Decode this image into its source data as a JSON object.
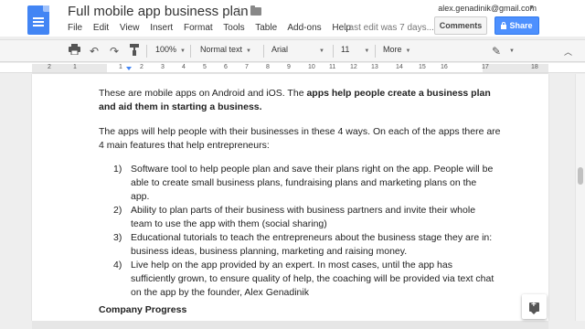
{
  "header": {
    "title": "Full mobile app business plan",
    "menu": [
      "File",
      "Edit",
      "View",
      "Insert",
      "Format",
      "Tools",
      "Table",
      "Add-ons",
      "Help"
    ],
    "last_edit": "Last edit was 7 days...",
    "account": "alex.genadinik@gmail.com",
    "comments_label": "Comments",
    "share_label": "Share"
  },
  "toolbar": {
    "zoom": "100%",
    "style": "Normal text",
    "font": "Arial",
    "size": "11",
    "more": "More"
  },
  "ruler": {
    "numbers": [
      "2",
      "1",
      "1",
      "2",
      "3",
      "4",
      "5",
      "6",
      "7",
      "8",
      "9",
      "10",
      "11",
      "12",
      "13",
      "14",
      "15",
      "16",
      "17",
      "18"
    ]
  },
  "document": {
    "para1_plain": "These are mobile apps on Android and iOS. The ",
    "para1_bold": "apps help people create a business plan and aid them in starting a business.",
    "para2": "The apps will help people with their businesses in these 4 ways. On each of the apps there are 4 main features that help entrepreneurs:",
    "list": [
      {
        "num": "1)",
        "text": "Software tool to help people plan and save their plans right on the app. People will be able to create small business plans, fundraising plans and marketing plans on the app."
      },
      {
        "num": "2)",
        "text": "Ability to plan parts of their business with business partners and invite their whole team to use the app with them (social sharing)"
      },
      {
        "num": "3)",
        "text": "Educational tutorials to teach the entrepreneurs about the business stage they are in: business ideas, business planning, marketing and raising money."
      },
      {
        "num": "4)",
        "text": "Live help on the app provided by an expert. In most cases, until the app has sufficiently grown, to ensure quality of help, the coaching will be provided via text chat on the app by the founder, Alex Genadinik"
      }
    ],
    "heading": "Company Progress"
  },
  "icons": {
    "star": "star-icon",
    "folder": "folder-icon",
    "print": "print-icon",
    "undo": "undo-icon",
    "redo": "redo-icon",
    "paint_format": "paint-format-icon",
    "pen": "pen-icon",
    "explore": "explore-icon"
  },
  "colors": {
    "accent": "#4285f4",
    "share": "#4d90fe"
  }
}
